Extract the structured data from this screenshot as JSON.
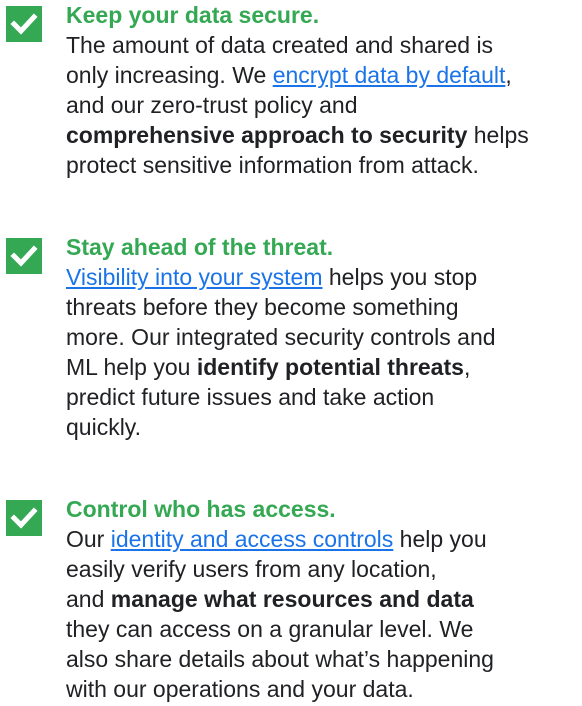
{
  "features": [
    {
      "title": "Keep your data secure.",
      "icon": "checkmark-icon",
      "lines": [
        [
          "The amount of data created and shared is"
        ],
        [
          "only increasing. We ",
          "encrypt data by default",
          ","
        ],
        [
          "and our zero-trust policy and"
        ],
        [
          "comprehensive approach to security",
          " helps"
        ],
        [
          "protect sensitive information from attack."
        ]
      ]
    },
    {
      "title": "Stay ahead of the threat.",
      "icon": "checkmark-icon",
      "lines": [
        [
          "Visibility into your system",
          " helps you stop"
        ],
        [
          "threats before they become something"
        ],
        [
          "more. Our integrated security controls and"
        ],
        [
          "ML help you ",
          "identify potential threats",
          ","
        ],
        [
          "predict future issues and take action"
        ],
        [
          "quickly."
        ]
      ]
    },
    {
      "title": "Control who has access.",
      "icon": "checkmark-icon",
      "lines": [
        [
          "Our ",
          "identity and access controls",
          " help you"
        ],
        [
          "easily verify users from any location,"
        ],
        [
          "and ",
          "manage what resources and data"
        ],
        [
          "they can access on a granular level. We"
        ],
        [
          "also share details about what’s happening"
        ],
        [
          "with our operations and your data."
        ]
      ]
    }
  ],
  "colors": {
    "accent_green": "#34a853",
    "link_blue": "#1a73e8",
    "text": "#202124",
    "check_bg": "#34a853",
    "check_mark": "#ffffff"
  }
}
